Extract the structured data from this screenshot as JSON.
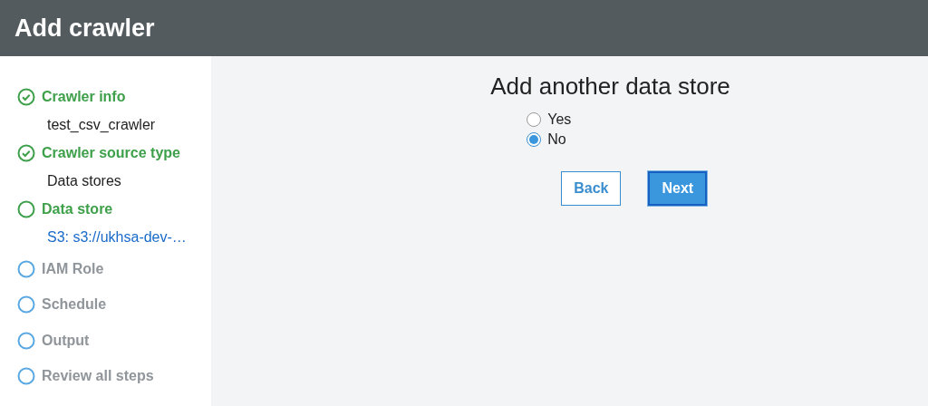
{
  "header": {
    "title": "Add crawler"
  },
  "steps": [
    {
      "label": "Crawler info",
      "done": true,
      "current": false,
      "detail": {
        "text": "test_csv_crawler",
        "kind": "text"
      }
    },
    {
      "label": "Crawler source type",
      "done": true,
      "current": false,
      "detail": {
        "text": "Data stores",
        "kind": "text"
      }
    },
    {
      "label": "Data store",
      "done": false,
      "current": true,
      "detail": {
        "text": "S3: s3://ukhsa-dev-…",
        "kind": "link"
      }
    },
    {
      "label": "IAM Role",
      "done": false,
      "current": false
    },
    {
      "label": "Schedule",
      "done": false,
      "current": false
    },
    {
      "label": "Output",
      "done": false,
      "current": false
    },
    {
      "label": "Review all steps",
      "done": false,
      "current": false
    }
  ],
  "main": {
    "title": "Add another data store",
    "options": [
      {
        "label": "Yes",
        "selected": false
      },
      {
        "label": "No",
        "selected": true
      }
    ],
    "buttons": [
      {
        "label": "Back",
        "kind": "secondary"
      },
      {
        "label": "Next",
        "kind": "primary"
      }
    ]
  }
}
